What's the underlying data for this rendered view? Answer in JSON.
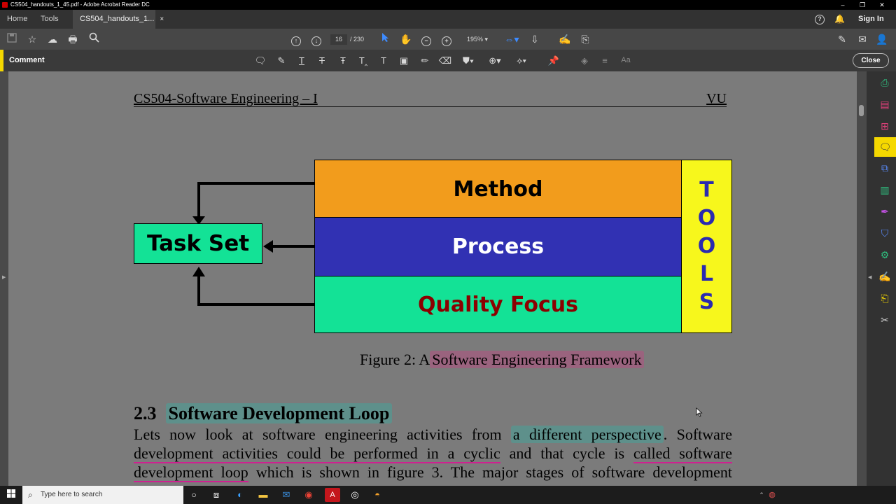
{
  "window": {
    "title": "CS504_handouts_1_45.pdf - Adobe Acrobat Reader DC",
    "controls": [
      "–",
      "❐",
      "✕"
    ]
  },
  "tabs": [
    {
      "label": "Home"
    },
    {
      "label": "Tools"
    },
    {
      "label": "CS504_handouts_1...",
      "close": "×"
    }
  ],
  "account": {
    "help": "?",
    "sign_in": "Sign In"
  },
  "toolbar": {
    "current_page": "16",
    "page_total": "/ 230",
    "zoom": "195%"
  },
  "comment_bar": {
    "label": "Comment",
    "close": "Close"
  },
  "document": {
    "header_left": "CS504-Software Engineering – I",
    "header_right": "VU",
    "figure": {
      "task_set": "Task Set",
      "method": "Method",
      "process": "Process",
      "quality": "Quality Focus",
      "tools": [
        "T",
        "O",
        "O",
        "L",
        "S"
      ],
      "colors": {
        "method": "#f29c1c",
        "process": "#3131b3",
        "quality": "#13e296",
        "tools": "#f7f71c",
        "task_set": "#13e296",
        "quality_text": "#8b0000",
        "tools_text": "#2a2ab0"
      }
    },
    "caption_prefix": "Figure 2: A",
    "caption_highlight": "Software Engineering Framework",
    "section_number": "2.3",
    "section_title": "Software Development Loop",
    "line1_a": "Lets now look at software engineering activities from",
    "line1_hl": "a different perspective",
    "line1_b": ". Software",
    "line2_a": "development activities could be performed in a cyclic",
    "line2_b": "and that cycle is",
    "line2_c": "called software",
    "line3_a": "development loop",
    "line3_b": "which is shown in figure 3. The major stages of software development"
  },
  "taskbar": {
    "search_placeholder": "Type here to search",
    "pinned_icons": [
      "task-view-icon",
      "timeline-icon",
      "edge-icon",
      "file-explorer-icon",
      "mail-icon",
      "chrome-icon",
      "acrobat-icon",
      "obs-icon",
      "app-icon"
    ]
  }
}
